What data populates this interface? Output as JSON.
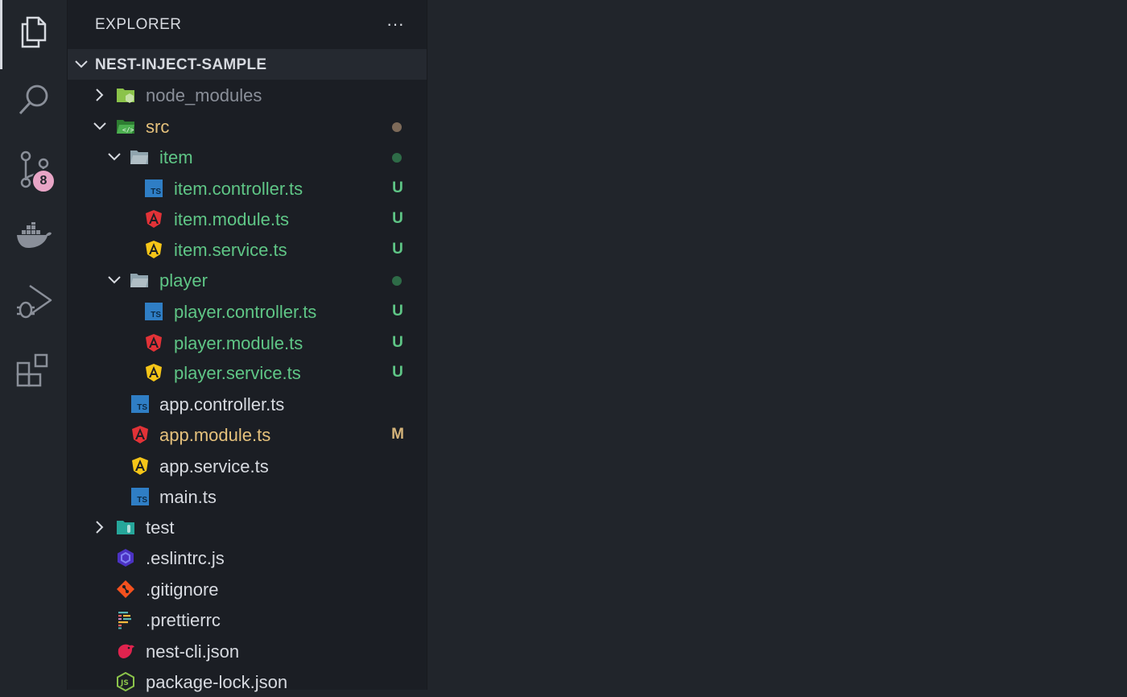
{
  "explorer": {
    "title": "EXPLORER",
    "more_actions": "···",
    "project": "NEST-INJECT-SAMPLE"
  },
  "activity_bar": {
    "items": [
      "files-icon",
      "search-icon",
      "source-control-icon",
      "docker-icon",
      "run-debug-icon",
      "extensions-icon"
    ],
    "source_control_badge": "8"
  },
  "tree": {
    "node_modules": "node_modules",
    "src": "src",
    "item": "item",
    "item_controller": "item.controller.ts",
    "item_module": "item.module.ts",
    "item_service": "item.service.ts",
    "player": "player",
    "player_controller": "player.controller.ts",
    "player_module": "player.module.ts",
    "player_service": "player.service.ts",
    "app_controller": "app.controller.ts",
    "app_module": "app.module.ts",
    "app_service": "app.service.ts",
    "main": "main.ts",
    "test": "test",
    "eslintrc": ".eslintrc.js",
    "gitignore": ".gitignore",
    "prettierrc": ".prettierrc",
    "nest_cli": "nest-cli.json",
    "package_lock": "package-lock.json"
  },
  "status": {
    "untracked": "U",
    "modified": "M"
  },
  "colors": {
    "untracked_green": "#5fc686",
    "modified_yellow": "#e5c17c",
    "dim": "#8a8f99",
    "angular_red": "#e23237",
    "angular_yellow": "#f5c518",
    "ts_blue": "#2f7ec5"
  }
}
